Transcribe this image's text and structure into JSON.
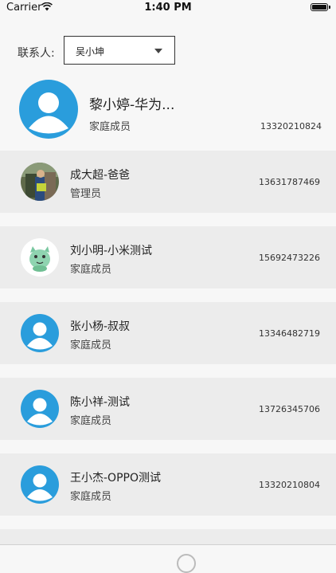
{
  "status_bar": {
    "carrier": "Carrier",
    "time": "1:40 PM"
  },
  "contact_filter": {
    "label": "联系人:",
    "selected": "吴小坤"
  },
  "current_contact": {
    "name": "黎小婷-华为...",
    "role": "家庭成员",
    "phone": "13320210824",
    "avatar_icon": "default-user-avatar"
  },
  "members": [
    {
      "name": "成大超-爸爸",
      "role": "管理员",
      "phone": "13631787469",
      "avatar_icon": "photo-avatar"
    },
    {
      "name": "刘小明-小米测试",
      "role": "家庭成员",
      "phone": "15692473226",
      "avatar_icon": "green-cartoon-avatar"
    },
    {
      "name": "张小杨-叔叔",
      "role": "家庭成员",
      "phone": "13346482719",
      "avatar_icon": "default-user-avatar"
    },
    {
      "name": "陈小祥-测试",
      "role": "家庭成员",
      "phone": "13726345706",
      "avatar_icon": "default-user-avatar"
    },
    {
      "name": "王小杰-OPPO测试",
      "role": "家庭成员",
      "phone": "13320210804",
      "avatar_icon": "default-user-avatar"
    }
  ],
  "colors": {
    "avatar_blue": "#2a9ddc",
    "row_background": "#ececec",
    "page_background": "#f7f7f7"
  }
}
